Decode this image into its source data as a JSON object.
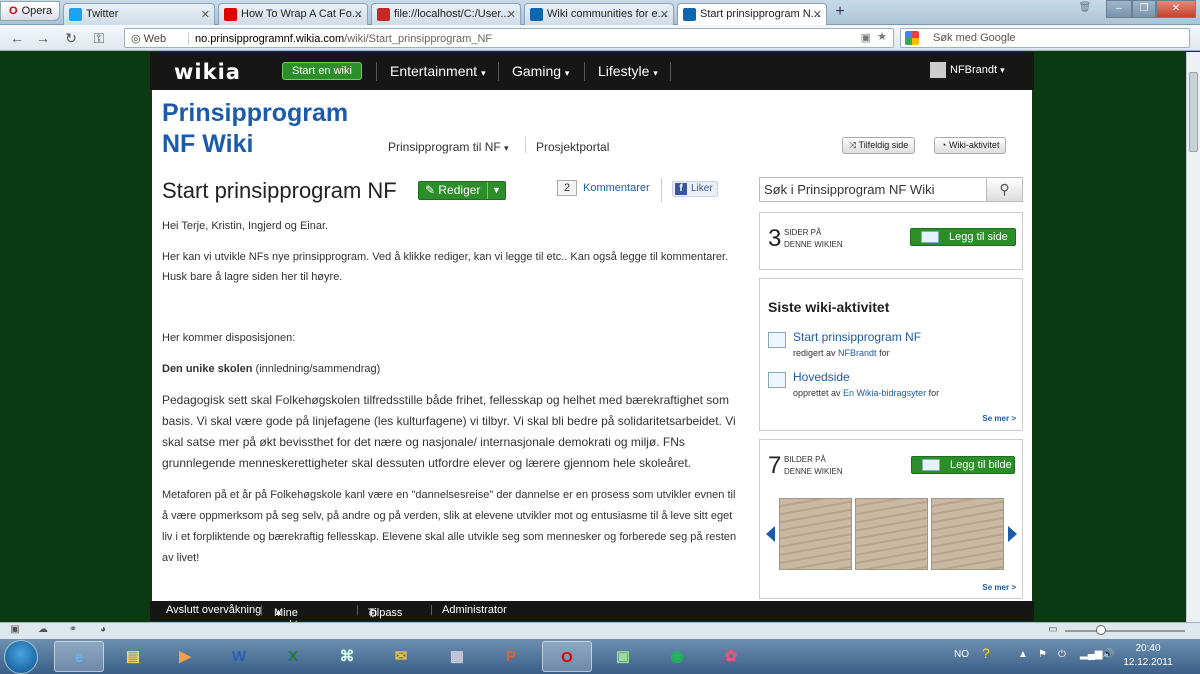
{
  "browser": {
    "opera_label": "Opera",
    "tabs": [
      {
        "label": "Twitter",
        "favicon_color": "#1da1f2"
      },
      {
        "label": "How To Wrap A Cat Fo...",
        "favicon_color": "#e00000"
      },
      {
        "label": "file://localhost/C:/User...",
        "favicon_color": "#c62828"
      },
      {
        "label": "Wiki communities for e...",
        "favicon_color": "#0e66b1"
      },
      {
        "label": "Start prinsipprogram N...",
        "favicon_color": "#0e66b1"
      }
    ],
    "security_label": "Web",
    "url_domain": "no.prinsipprogramnf.wikia.com",
    "url_path": "/wiki/Start_prinsipprogram_NF",
    "search_placeholder": "Søk med Google"
  },
  "wikia_nav": {
    "logo": "wikia",
    "start_button": "Start en wiki",
    "items": [
      "Entertainment",
      "Gaming",
      "Lifestyle"
    ],
    "user": "NFBrandt"
  },
  "wiki_header": {
    "title_line1": "Prinsipprogram",
    "title_line2": "NF Wiki",
    "nav_item1": "Prinsipprogram til NF",
    "nav_item2": "Prosjektportal",
    "random_page": "Tilfeldig side",
    "wiki_activity": "Wiki-aktivitet"
  },
  "article": {
    "title": "Start prinsipprogram NF",
    "edit_label": "Rediger",
    "comment_count": "2",
    "comments_label": "Kommentarer",
    "like_label": "Liker",
    "p1": "Hei Terje, Kristin, Ingjerd og Einar.",
    "p2": "Her kan vi utvikle NFs nye prinsipprogram. Ved å klikke rediger, kan vi legge til etc.. Kan også legge til kommentarer. Husk bare å lagre siden her til høyre.",
    "p3": "Her kommer disposisjonen:",
    "p4_bold": "Den unike skolen",
    "p4_rest": " (innledning/sammendrag)",
    "p5": "Pedagogisk sett skal Folkehøgskolen tilfredsstille både frihet, fellesskap og helhet med bærekraftighet som basis. Vi skal være gode på linjefagene (les kulturfagene) vi tilbyr. Vi skal bli bedre på solidaritetsarbeidet. Vi skal satse mer på økt bevissthet for det nære og nasjonale/ internasjonale demokrati og miljø. FNs grunnlegende menneskerettigheter skal dessuten utfordre elever og lærere gjennom hele skoleåret.",
    "p6": "Metaforen på et år på Folkehøgskole kanl være en \"dannelsesreise\" der dannelse er en prosess som utvikler evnen til å være oppmerksom på seg selv, på andre og på verden, slik at elevene utvikler mot og entusiasme til å leve sitt eget liv i et forpliktende og bærekraftig fellesskap. Elevene skal alle utvikle seg som mennesker og forberede seg på resten av livet!"
  },
  "rail": {
    "search_placeholder": "Søk i Prinsipprogram NF Wiki",
    "pages_count": "3",
    "pages_label": "SIDER PÅ DENNE WIKIEN",
    "add_page": "Legg til side",
    "activity_title": "Siste wiki-aktivitet",
    "activity": [
      {
        "title": "Start prinsipprogram NF",
        "verb": "redigert av",
        "user": "NFBrandt",
        "suffix": "for"
      },
      {
        "title": "Hovedside",
        "verb": "opprettet av",
        "user": "En Wikia-bidragsyter",
        "suffix": "for"
      }
    ],
    "see_more": "Se mer >",
    "images_count": "7",
    "images_label": "BILDER PÅ DENNE WIKIEN",
    "add_image": "Legg til bilde"
  },
  "toolbar": {
    "unfollow": "Avslutt overvåkning",
    "my_tools": "Mine verktøy",
    "customize": "Tilpass",
    "admin": "Administrator"
  },
  "taskbar": {
    "lang": "NO",
    "time": "20:40",
    "date": "12.12.2011"
  },
  "colors": {
    "wikia_green": "#2c8e28",
    "wiki_link_blue": "#1c5ba9",
    "page_background": "#0b3a12"
  }
}
